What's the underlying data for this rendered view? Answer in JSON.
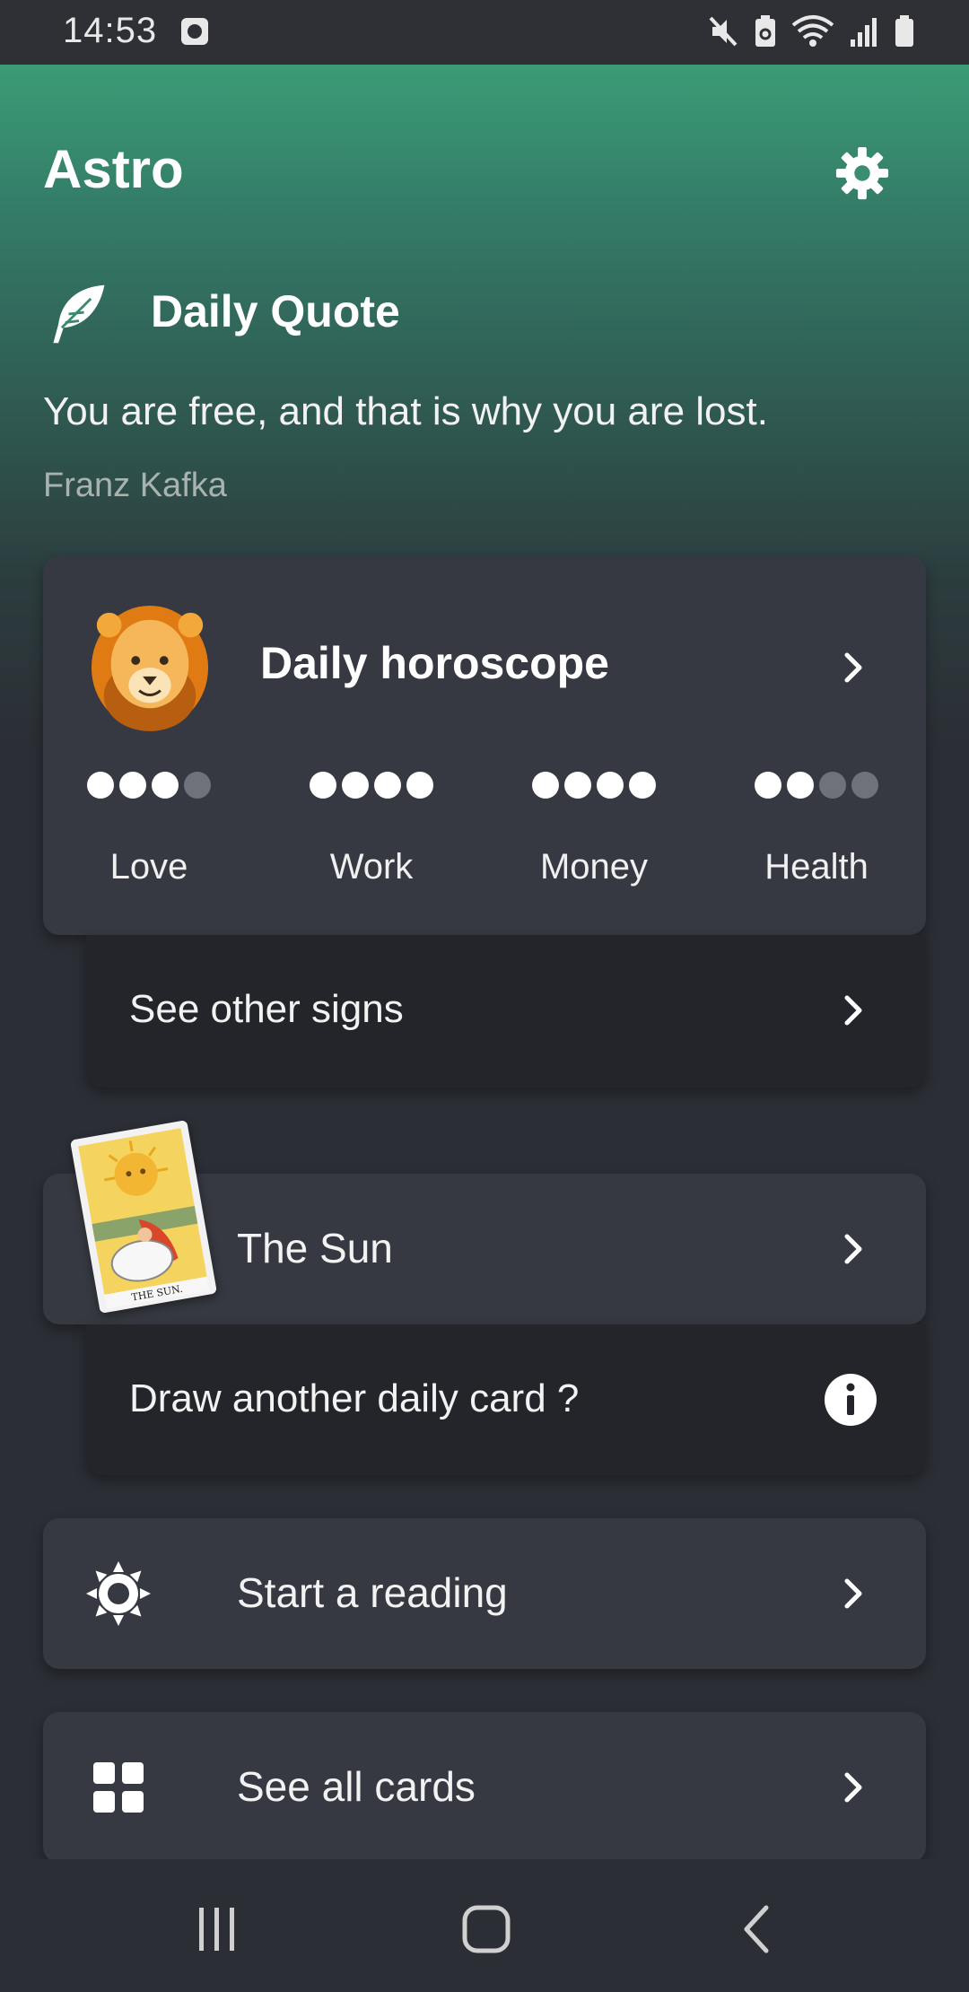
{
  "status_bar": {
    "time": "14:53",
    "icons": [
      "clock-app-icon",
      "mute-icon",
      "battery-saver-icon",
      "wifi-icon",
      "signal-icon",
      "battery-icon"
    ]
  },
  "header": {
    "title": "Astro",
    "settings_icon": "gear-icon"
  },
  "daily_quote": {
    "title": "Daily Quote",
    "icon": "feather-icon",
    "text": "You are free, and that is why you are lost.",
    "author": "Franz Kafka"
  },
  "horoscope": {
    "title": "Daily horoscope",
    "sign_icon": "lion-icon",
    "stats": [
      {
        "label": "Love",
        "rating": 3,
        "max": 4
      },
      {
        "label": "Work",
        "rating": 4,
        "max": 4
      },
      {
        "label": "Money",
        "rating": 4,
        "max": 4
      },
      {
        "label": "Health",
        "rating": 2,
        "max": 4
      }
    ],
    "other_signs_label": "See other signs"
  },
  "daily_card": {
    "name": "The Sun",
    "card_caption": "THE SUN.",
    "draw_another_label": "Draw another daily card ?"
  },
  "menu": {
    "start_reading": "Start a reading",
    "see_all_cards": "See all cards"
  },
  "colors": {
    "accent": "#3b9c76",
    "card": "#363941",
    "subcard": "#23252b",
    "background": "#2b2e35"
  }
}
